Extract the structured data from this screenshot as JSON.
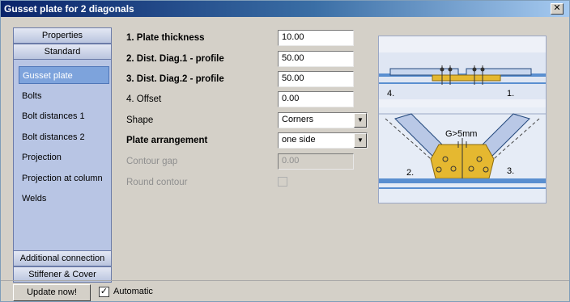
{
  "window": {
    "title": "Gusset plate for 2 diagonals",
    "close_glyph": "✕"
  },
  "nav": {
    "header_top": [
      "Properties",
      "Standard"
    ],
    "items": [
      "Gusset plate",
      "Bolts",
      "Bolt distances 1",
      "Bolt distances 2",
      "Projection",
      "Projection at column",
      "Welds"
    ],
    "selected_index": 0,
    "header_bottom": [
      "Additional connection",
      "Stiffener & Cover"
    ],
    "scroll_left": "◀",
    "scroll_right": "▶"
  },
  "form": {
    "fields": [
      {
        "label": "1. Plate thickness",
        "value": "10.00",
        "bold": true
      },
      {
        "label": "2. Dist. Diag.1 - profile",
        "value": "50.00",
        "bold": true
      },
      {
        "label": "3. Dist. Diag.2 - profile",
        "value": "50.00",
        "bold": true
      },
      {
        "label": "4. Offset",
        "value": "0.00",
        "bold": false
      }
    ],
    "shape": {
      "label": "Shape",
      "value": "Corners"
    },
    "arrangement": {
      "label": "Plate arrangement",
      "value": "one side"
    },
    "contour_gap": {
      "label": "Contour gap",
      "value": "0.00"
    },
    "round_contour": {
      "label": "Round contour",
      "checked": false
    },
    "dropdown_glyph": "▼"
  },
  "diagram": {
    "labels": {
      "four": "4.",
      "one": "1.",
      "two": "2.",
      "three": "3.",
      "gap": "G>5mm"
    },
    "colors": {
      "steel": "#5a8fd0",
      "plate": "#e5b830",
      "plate_edge": "#8a6a10",
      "background": "#eef1f8"
    }
  },
  "footer": {
    "update_label": "Update now!",
    "automatic_label": "Automatic",
    "automatic_checked": true,
    "check_glyph": "✓"
  }
}
